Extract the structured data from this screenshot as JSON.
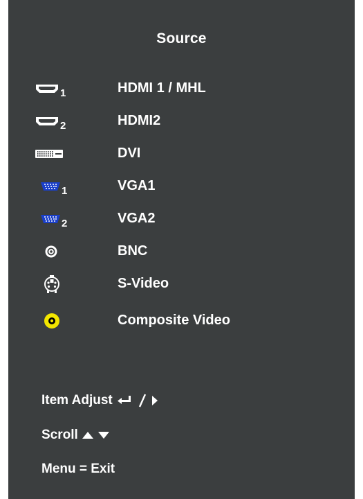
{
  "osd": {
    "title": "Source",
    "sources": [
      {
        "label": "HDMI 1 / MHL",
        "icon": "hdmi-icon",
        "sub": "1"
      },
      {
        "label": "HDMI2",
        "icon": "hdmi-icon",
        "sub": "2"
      },
      {
        "label": "DVI",
        "icon": "dvi-icon",
        "sub": ""
      },
      {
        "label": "VGA1",
        "icon": "vga-icon",
        "sub": "1"
      },
      {
        "label": "VGA2",
        "icon": "vga-icon",
        "sub": "2"
      },
      {
        "label": "BNC",
        "icon": "bnc-icon",
        "sub": ""
      },
      {
        "label": "S-Video",
        "icon": "s-video-icon",
        "sub": ""
      },
      {
        "label": "Composite Video",
        "icon": "composite-video-icon",
        "sub": ""
      }
    ],
    "help": {
      "item_adjust": "Item Adjust",
      "scroll": "Scroll",
      "menu_exit": "Menu = Exit"
    },
    "colors": {
      "panel": "#3b3e3f",
      "text": "#ffffff",
      "vga_blue": "#1a3fc9",
      "composite_yellow": "#f3e600"
    }
  }
}
